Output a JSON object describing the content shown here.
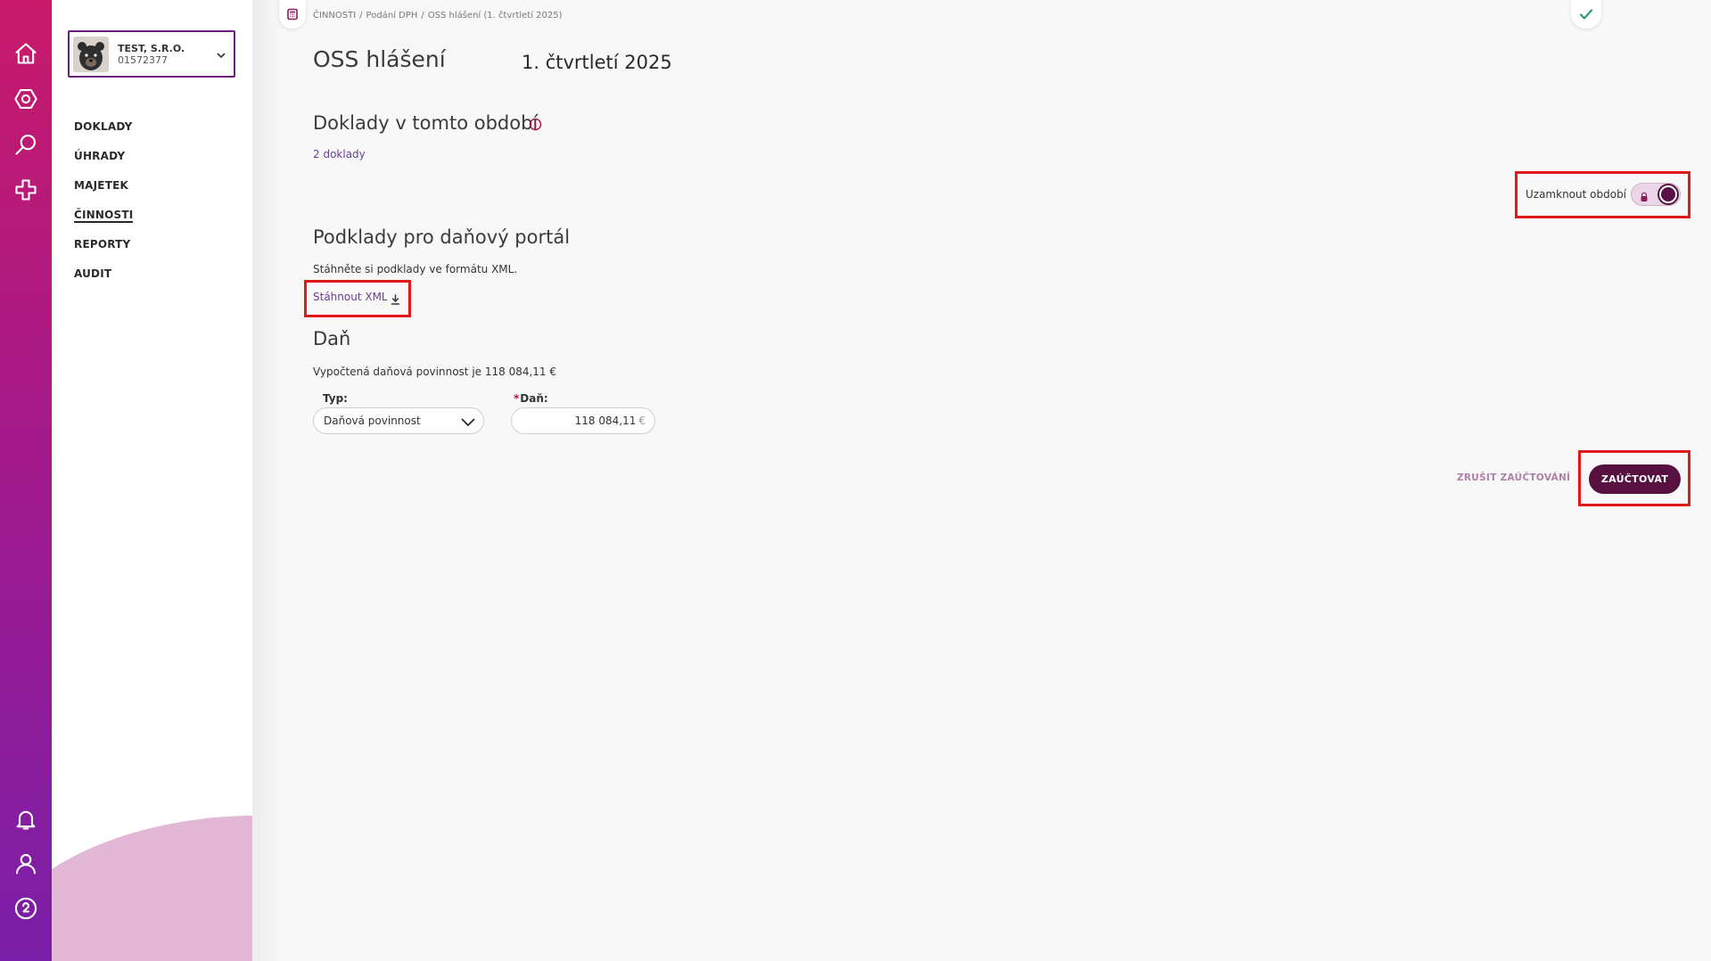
{
  "rail": {
    "top_icons": [
      "home-icon",
      "settings-hex-icon",
      "search-icon",
      "plus-cross-icon"
    ],
    "bottom_icons": [
      "bell-icon",
      "user-icon",
      "help-icon"
    ]
  },
  "company": {
    "name": "TEST, S.R.O.",
    "ico": "01572377"
  },
  "nav": {
    "items": [
      {
        "label": "DOKLADY"
      },
      {
        "label": "ÚHRADY"
      },
      {
        "label": "MAJETEK"
      },
      {
        "label": "ČINNOSTI"
      },
      {
        "label": "REPORTY"
      },
      {
        "label": "AUDIT"
      }
    ],
    "active": "ČINNOSTI"
  },
  "breadcrumb": {
    "items": [
      "ČINNOSTI",
      "Podání DPH",
      "OSS hlášení (1. čtvrtletí 2025)"
    ],
    "separator": "/"
  },
  "header": {
    "title": "OSS hlášení",
    "period": "1. čtvrtletí 2025"
  },
  "documents": {
    "heading": "Doklady v tomto období",
    "count_link": "2 doklady"
  },
  "lock": {
    "label": "Uzamknout období",
    "enabled": true
  },
  "portal": {
    "heading": "Podklady pro daňový portál",
    "description": "Stáhněte si podklady ve formátu XML.",
    "download_link": "Stáhnout XML"
  },
  "tax": {
    "heading": "Daň",
    "summary": "Vypočtená daňová povinnost je 118 084,11 €",
    "type_label": "Typ:",
    "type_value": "Daňová povinnost",
    "amount_label": "Daň:",
    "amount_value": "118 084,11",
    "currency": "€"
  },
  "actions": {
    "cancel": "ZRUŠIT ZAÚČTOVÁNÍ",
    "post": "ZAÚČTOVAT"
  },
  "colors": {
    "accent": "#57103f",
    "highlight": "#e01818",
    "link": "#6a3f8f",
    "rail_top": "#c8196a",
    "rail_bottom": "#7a1fa8"
  }
}
